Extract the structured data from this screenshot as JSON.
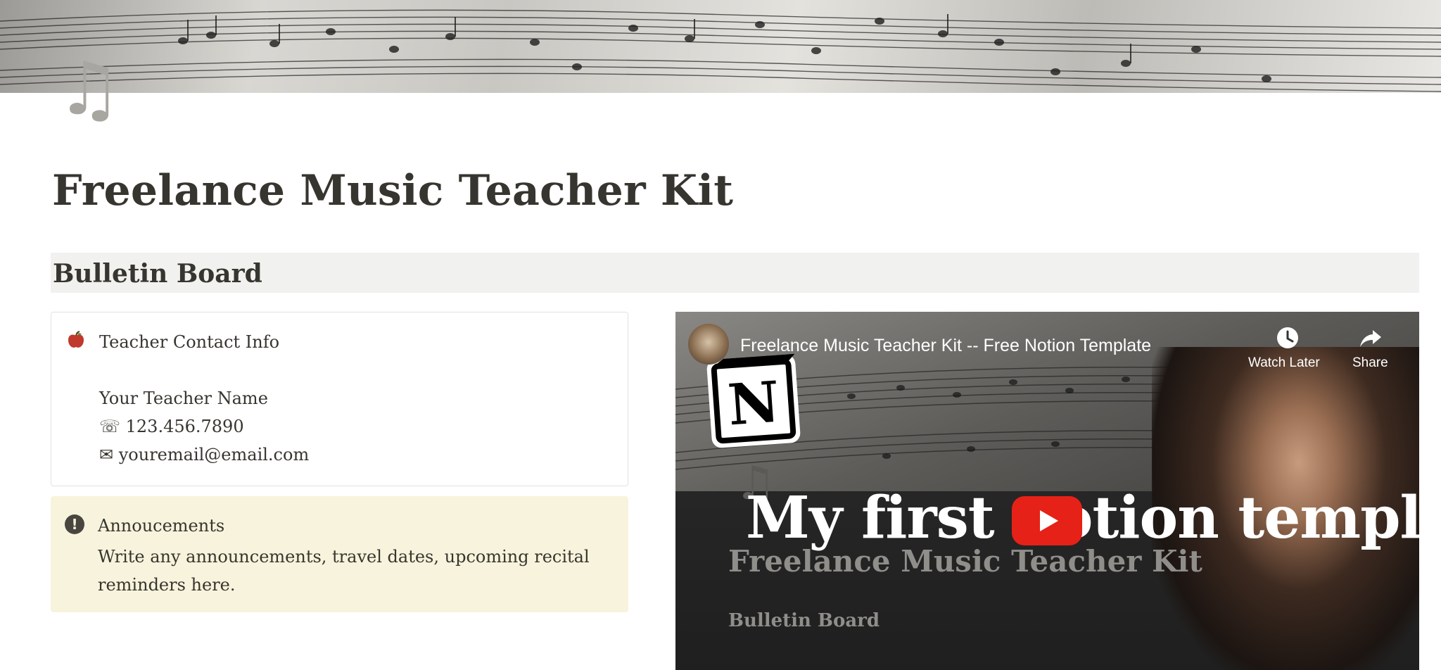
{
  "page": {
    "icon_name": "music-note-icon",
    "title": "Freelance Music Teacher Kit"
  },
  "bulletin": {
    "heading": "Bulletin Board"
  },
  "contact_callout": {
    "icon_name": "apple-icon",
    "title": "Teacher Contact Info",
    "name": "Your Teacher Name",
    "phone": "☏ 123.456.7890",
    "email": "✉ youremail@email.com"
  },
  "announcement_callout": {
    "icon_name": "exclamation-icon",
    "title": "Annoucements",
    "body": "Write any announcements, travel dates, upcoming recital reminders here.",
    "background": "#f8f3dc"
  },
  "video": {
    "title": "Freelance Music Teacher Kit -- Free Notion Template",
    "watch_later_label": "Watch Later",
    "share_label": "Share",
    "headline": "My first notion template",
    "kit_title": "Freelance Music Teacher Kit",
    "kit_bulletin": "Bulletin Board",
    "logo_letter": "N",
    "play_color": "#e62117"
  }
}
